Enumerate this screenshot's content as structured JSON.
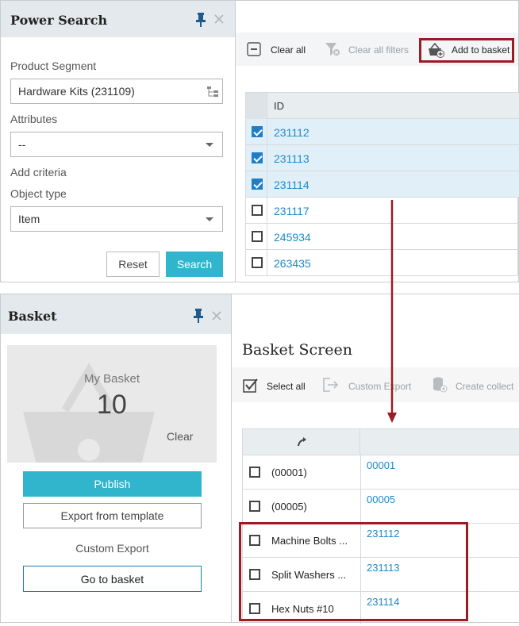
{
  "power_search": {
    "title": "Power Search",
    "product_segment_label": "Product Segment",
    "product_segment_value": "Hardware Kits (231109)",
    "attributes_label": "Attributes",
    "attributes_value": "--",
    "add_criteria": "Add criteria",
    "object_type_label": "Object type",
    "object_type_value": "Item",
    "reset": "Reset",
    "search": "Search"
  },
  "search_toolbar": {
    "clear_all": "Clear all",
    "clear_all_filters": "Clear all filters",
    "add_to_basket": "Add to basket"
  },
  "results": {
    "column_id": "ID",
    "rows": [
      {
        "id": "231112",
        "checked": true
      },
      {
        "id": "231113",
        "checked": true
      },
      {
        "id": "231114",
        "checked": true
      },
      {
        "id": "231117",
        "checked": false
      },
      {
        "id": "245934",
        "checked": false
      },
      {
        "id": "263435",
        "checked": false
      }
    ]
  },
  "basket": {
    "title": "Basket",
    "my_basket": "My Basket",
    "count": "10",
    "clear": "Clear",
    "publish": "Publish",
    "export_from_template": "Export from template",
    "custom_export": "Custom Export",
    "go_to_basket": "Go to basket"
  },
  "basket_screen": {
    "title": "Basket Screen",
    "select_all": "Select all",
    "custom_export": "Custom Export",
    "create_collection": "Create collect",
    "rows": [
      {
        "name": "(00001)",
        "id": "00001"
      },
      {
        "name": "(00005)",
        "id": "00005"
      },
      {
        "name": "Machine Bolts ...",
        "id": "231112"
      },
      {
        "name": "Split Washers ...",
        "id": "231113"
      },
      {
        "name": "Hex Nuts #10",
        "id": "231114"
      }
    ]
  },
  "colors": {
    "accent": "#30b5cc",
    "link": "#1d8ac8",
    "highlight_frame": "#9b1c24",
    "header_bg": "#e3e9ec"
  }
}
